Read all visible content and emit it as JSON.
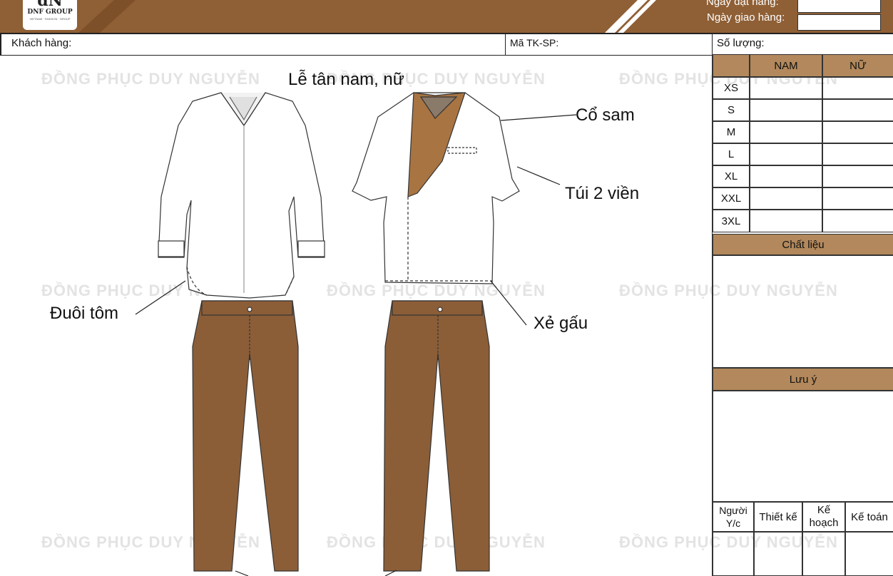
{
  "header": {
    "logo_mark": "dN",
    "logo_text": "DNF GROUP",
    "logo_sub": "VIETNAM · FASHION · GROUP",
    "order_date_label": "Ngày đặt hàng:",
    "delivery_date_label": "Ngày giao hàng:"
  },
  "info": {
    "customer_label": "Khách hàng:",
    "code_label": "Mã TK-SP:",
    "quantity_label": "Số lượng:"
  },
  "watermark": "ĐỒNG PHỤC DUY NGUYỄN",
  "design": {
    "title": "Lễ tân nam, nữ",
    "callouts": {
      "shrimp_hem": "Đuôi tôm",
      "collar": "Cổ sam",
      "pocket": "Túi 2 viền",
      "slit": "Xẻ gấu"
    }
  },
  "size_table": {
    "headers": [
      "NAM",
      "NỮ"
    ],
    "sizes": [
      "XS",
      "S",
      "M",
      "L",
      "XL",
      "XXL",
      "3XL"
    ]
  },
  "material_label": "Chất liệu",
  "notes_label": "Lưu ý",
  "signatures": [
    "Người Y/c",
    "Thiết kế",
    "Kế hoạch",
    "Kế toán"
  ],
  "colors": {
    "header_brown": "#8f5f35",
    "section_brown": "#b2885c",
    "trouser_brown": "#8b5e38",
    "collar_brown": "#a87442"
  }
}
